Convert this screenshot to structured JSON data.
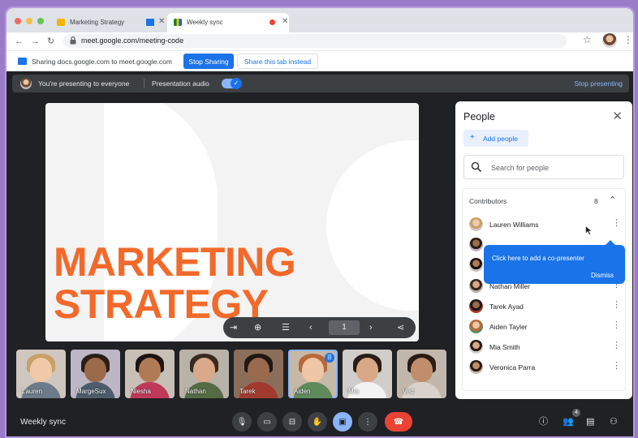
{
  "browser": {
    "tabs": [
      {
        "title": "Marketing Strategy",
        "close": "✕"
      },
      {
        "title": "Weekly sync",
        "close": "✕"
      }
    ],
    "url": "meet.google.com/meeting-code"
  },
  "sharebar": {
    "text": "Sharing docs.google.com to meet.google.com",
    "stop_label": "Stop Sharing",
    "share_tab_label": "Share this tab instead"
  },
  "presenting": {
    "text": "You're presenting to everyone",
    "audio_label": "Presentation audio",
    "audio_on": true,
    "stop_label": "Stop presenting"
  },
  "slide": {
    "title_line1": "MARKETING",
    "title_line2": "STRATEGY",
    "page": "1",
    "title_color": "#f26a2b"
  },
  "participants": [
    "Lauren",
    "MargeSux",
    "Niesha",
    "Nathan",
    "Tarek",
    "Aiden",
    "Mia",
    "Ved"
  ],
  "people_panel": {
    "title": "People",
    "add_label": "Add people",
    "search_placeholder": "Search for people",
    "contributors_label": "Contributors",
    "contributors_count": "8",
    "list": [
      "Lauren Williams",
      "",
      "",
      "Nathan Miller",
      "Tarek Ayad",
      "Aiden Tayler",
      "Mia Smith",
      "Veronica Parra"
    ]
  },
  "tooltip": {
    "text": "Click here to add a co-presenter",
    "dismiss": "Dismiss"
  },
  "meeting": {
    "title": "Weekly sync",
    "people_badge": "4"
  },
  "colors": {
    "accent": "#1a73e8",
    "end_call": "#ea4335",
    "present_active": "#8ab4f8"
  }
}
